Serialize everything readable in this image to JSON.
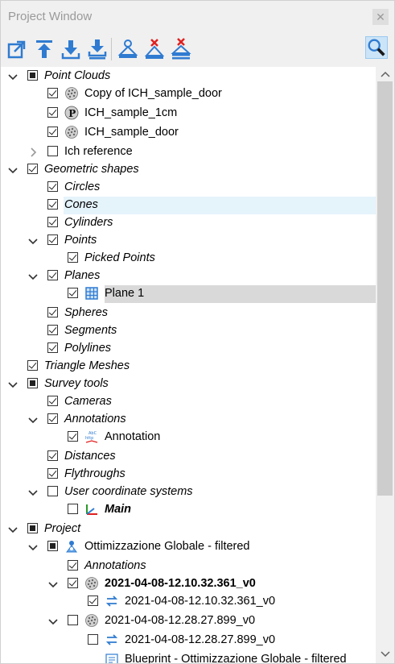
{
  "window": {
    "title": "Project Window",
    "close_glyph": "✕"
  },
  "toolbar": {
    "buttons": [
      {
        "name": "export-icon",
        "color": "#2f7bd1"
      },
      {
        "name": "upload-icon",
        "color": "#2f7bd1"
      },
      {
        "name": "download-icon",
        "color": "#2f7bd1"
      },
      {
        "name": "download-all-icon",
        "color": "#2f7bd1"
      },
      {
        "name": "pyramid-icon",
        "color": "#2f7bd1"
      },
      {
        "name": "pyramid-delete-icon",
        "color": "#e02020"
      },
      {
        "name": "pyramid-delete-all-icon",
        "color": "#e02020"
      },
      {
        "name": "search-icon",
        "color": "#2f7bd1"
      }
    ]
  },
  "tree": {
    "items": [
      {
        "label": "Point Clouds",
        "expand": "open",
        "check": "partial",
        "icon": "",
        "style": "i"
      },
      {
        "label": "Copy of ICH_sample_door",
        "expand": "",
        "check": "checked",
        "icon": "cloud-icon",
        "style": ""
      },
      {
        "label": "ICH_sample_1cm",
        "expand": "",
        "check": "checked",
        "icon": "p-icon",
        "style": ""
      },
      {
        "label": "ICH_sample_door",
        "expand": "",
        "check": "checked",
        "icon": "cloud-icon",
        "style": ""
      },
      {
        "label": "Ich reference",
        "expand": "closed",
        "check": "unchecked",
        "icon": "",
        "style": ""
      },
      {
        "label": "Geometric shapes",
        "expand": "open",
        "check": "checked",
        "icon": "",
        "style": "i"
      },
      {
        "label": "Circles",
        "expand": "",
        "check": "checked",
        "icon": "",
        "style": "i"
      },
      {
        "label": "Cones",
        "expand": "",
        "check": "checked",
        "icon": "",
        "style": "i",
        "state": "hover"
      },
      {
        "label": "Cylinders",
        "expand": "",
        "check": "checked",
        "icon": "",
        "style": "i"
      },
      {
        "label": "Points",
        "expand": "open",
        "check": "checked",
        "icon": "",
        "style": "i"
      },
      {
        "label": "Picked Points",
        "expand": "",
        "check": "checked",
        "icon": "",
        "style": "i"
      },
      {
        "label": "Planes",
        "expand": "open",
        "check": "checked",
        "icon": "",
        "style": "i"
      },
      {
        "label": "Plane 1",
        "expand": "",
        "check": "checked",
        "icon": "plane-icon",
        "style": "",
        "state": "selected"
      },
      {
        "label": "Spheres",
        "expand": "",
        "check": "checked",
        "icon": "",
        "style": "i"
      },
      {
        "label": "Segments",
        "expand": "",
        "check": "checked",
        "icon": "",
        "style": "i"
      },
      {
        "label": "Polylines",
        "expand": "",
        "check": "checked",
        "icon": "",
        "style": "i"
      },
      {
        "label": "Triangle Meshes",
        "expand": "",
        "check": "checked",
        "icon": "",
        "style": "i"
      },
      {
        "label": "Survey tools",
        "expand": "open",
        "check": "partial",
        "icon": "",
        "style": "i"
      },
      {
        "label": "Cameras",
        "expand": "",
        "check": "checked",
        "icon": "",
        "style": "i"
      },
      {
        "label": "Annotations",
        "expand": "open",
        "check": "checked",
        "icon": "",
        "style": "i"
      },
      {
        "label": "Annotation",
        "expand": "",
        "check": "checked",
        "icon": "annotation-icon",
        "style": ""
      },
      {
        "label": "Distances",
        "expand": "",
        "check": "checked",
        "icon": "",
        "style": "i"
      },
      {
        "label": "Flythroughs",
        "expand": "",
        "check": "checked",
        "icon": "",
        "style": "i"
      },
      {
        "label": "User coordinate systems",
        "expand": "open",
        "check": "unchecked",
        "icon": "",
        "style": "i"
      },
      {
        "label": "Main",
        "expand": "",
        "check": "unchecked",
        "icon": "axes-icon",
        "style": "bi"
      },
      {
        "label": "Project",
        "expand": "open",
        "check": "partial",
        "icon": "",
        "style": "i"
      },
      {
        "label": "Ottimizzazione Globale - filtered",
        "expand": "open",
        "check": "partial",
        "icon": "project-icon",
        "style": ""
      },
      {
        "label": "Annotations",
        "expand": "",
        "check": "checked",
        "icon": "",
        "style": "i"
      },
      {
        "label": "2021-04-08-12.10.32.361_v0",
        "expand": "open",
        "check": "checked",
        "icon": "cloud-icon",
        "style": "b"
      },
      {
        "label": "2021-04-08-12.10.32.361_v0",
        "expand": "",
        "check": "checked",
        "icon": "transform-icon",
        "style": ""
      },
      {
        "label": "2021-04-08-12.28.27.899_v0",
        "expand": "open",
        "check": "unchecked",
        "icon": "cloud-icon",
        "style": ""
      },
      {
        "label": "2021-04-08-12.28.27.899_v0",
        "expand": "",
        "check": "unchecked",
        "icon": "transform-icon",
        "style": ""
      },
      {
        "label": "Blueprint - Ottimizzazione Globale - filtered",
        "expand": "",
        "check": "",
        "icon": "blueprint-icon",
        "style": ""
      }
    ]
  }
}
